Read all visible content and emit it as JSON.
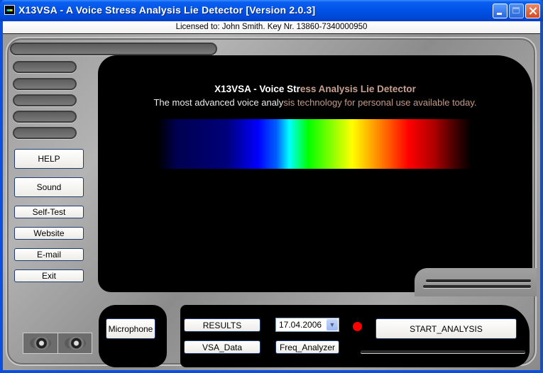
{
  "window": {
    "title": "X13VSA - A Voice Stress Analysis Lie Detector  [Version 2.0.3]",
    "controls": {
      "minimize": "minimize",
      "maximize": "maximize",
      "close": "close"
    }
  },
  "license_bar": {
    "text": "Licensed to: John Smith. Key Nr. 13860-7340000950"
  },
  "display": {
    "headline_main": "X13VSA - Voice Str",
    "headline_fade": "ess Analysis Lie Detector",
    "subline_main": "The most advanced voice analy",
    "subline_fade": "sis technology for personal use available today.",
    "spectrum_colors": [
      "#000050",
      "#0000ff",
      "#00ffff",
      "#00ff00",
      "#ffff00",
      "#ff8000",
      "#ff0000",
      "#400000"
    ]
  },
  "sidebar": {
    "buttons": [
      {
        "label": "HELP"
      },
      {
        "label": "Sound"
      },
      {
        "label": "Self-Test"
      },
      {
        "label": "Website"
      },
      {
        "label": "E-mail"
      },
      {
        "label": "Exit"
      }
    ]
  },
  "controls": {
    "microphone_label": "Microphone",
    "results_label": "RESULTS",
    "vsa_data_label": "VSA_Data",
    "date_value": "17.04.2006",
    "freq_analyzer_label": "Freq_Analyzer",
    "start_analysis_label": "START_ANALYSIS",
    "status_led_color": "#ff0000"
  }
}
